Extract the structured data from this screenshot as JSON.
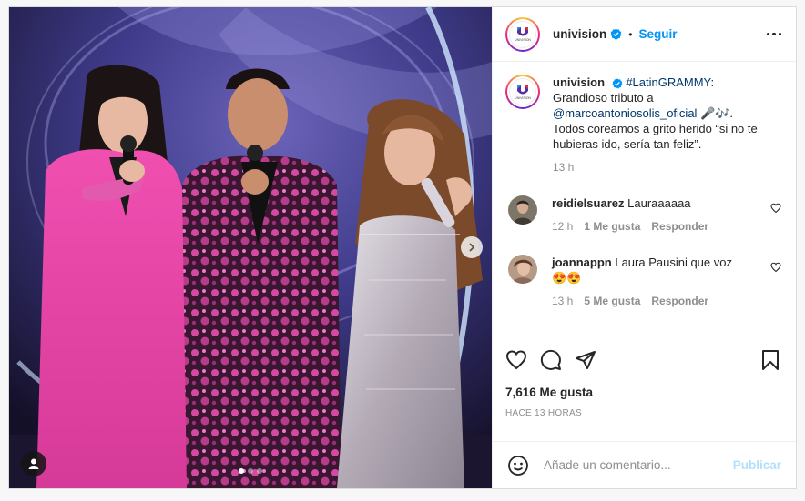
{
  "post": {
    "author": "univision",
    "follow_label": "Seguir",
    "separator": "•",
    "logo_text": "UNIVISION",
    "caption": {
      "hashtag": "#LatinGRAMMY",
      "line1_suffix": ":",
      "line2": "Grandioso tributo a",
      "mention": "@marcoantoniosolis_oficial",
      "mention_suffix": " 🎤🎶.",
      "line4": "Todos coreamos a grito herido “si no te hubieras ido, sería tan feliz”.",
      "time": "13 h"
    },
    "comments": [
      {
        "user": "reidielsuarez",
        "text": "Lauraaaaaa",
        "time": "12 h",
        "likes": "1 Me gusta",
        "reply": "Responder"
      },
      {
        "user": "joannappn",
        "text": "Laura Pausini que voz",
        "emoji": "😍😍",
        "time": "13 h",
        "likes": "5 Me gusta",
        "reply": "Responder"
      }
    ],
    "likes_label": "7,616 Me gusta",
    "posted_ago": "HACE 13 HORAS",
    "comment_placeholder": "Añade un comentario...",
    "publish_label": "Publicar"
  },
  "carousel": {
    "total": 3,
    "active": 1
  },
  "colors": {
    "accent_blue": "#0095f6",
    "link_blue": "#00376b",
    "publish_disabled": "#b2dffc",
    "text": "#262626",
    "muted": "#8e8e8e"
  },
  "icons": [
    "verified-badge-icon",
    "more-options-icon",
    "heart-icon",
    "comment-icon",
    "share-icon",
    "bookmark-icon",
    "emoji-icon",
    "chevron-right-icon",
    "user-tag-icon"
  ]
}
